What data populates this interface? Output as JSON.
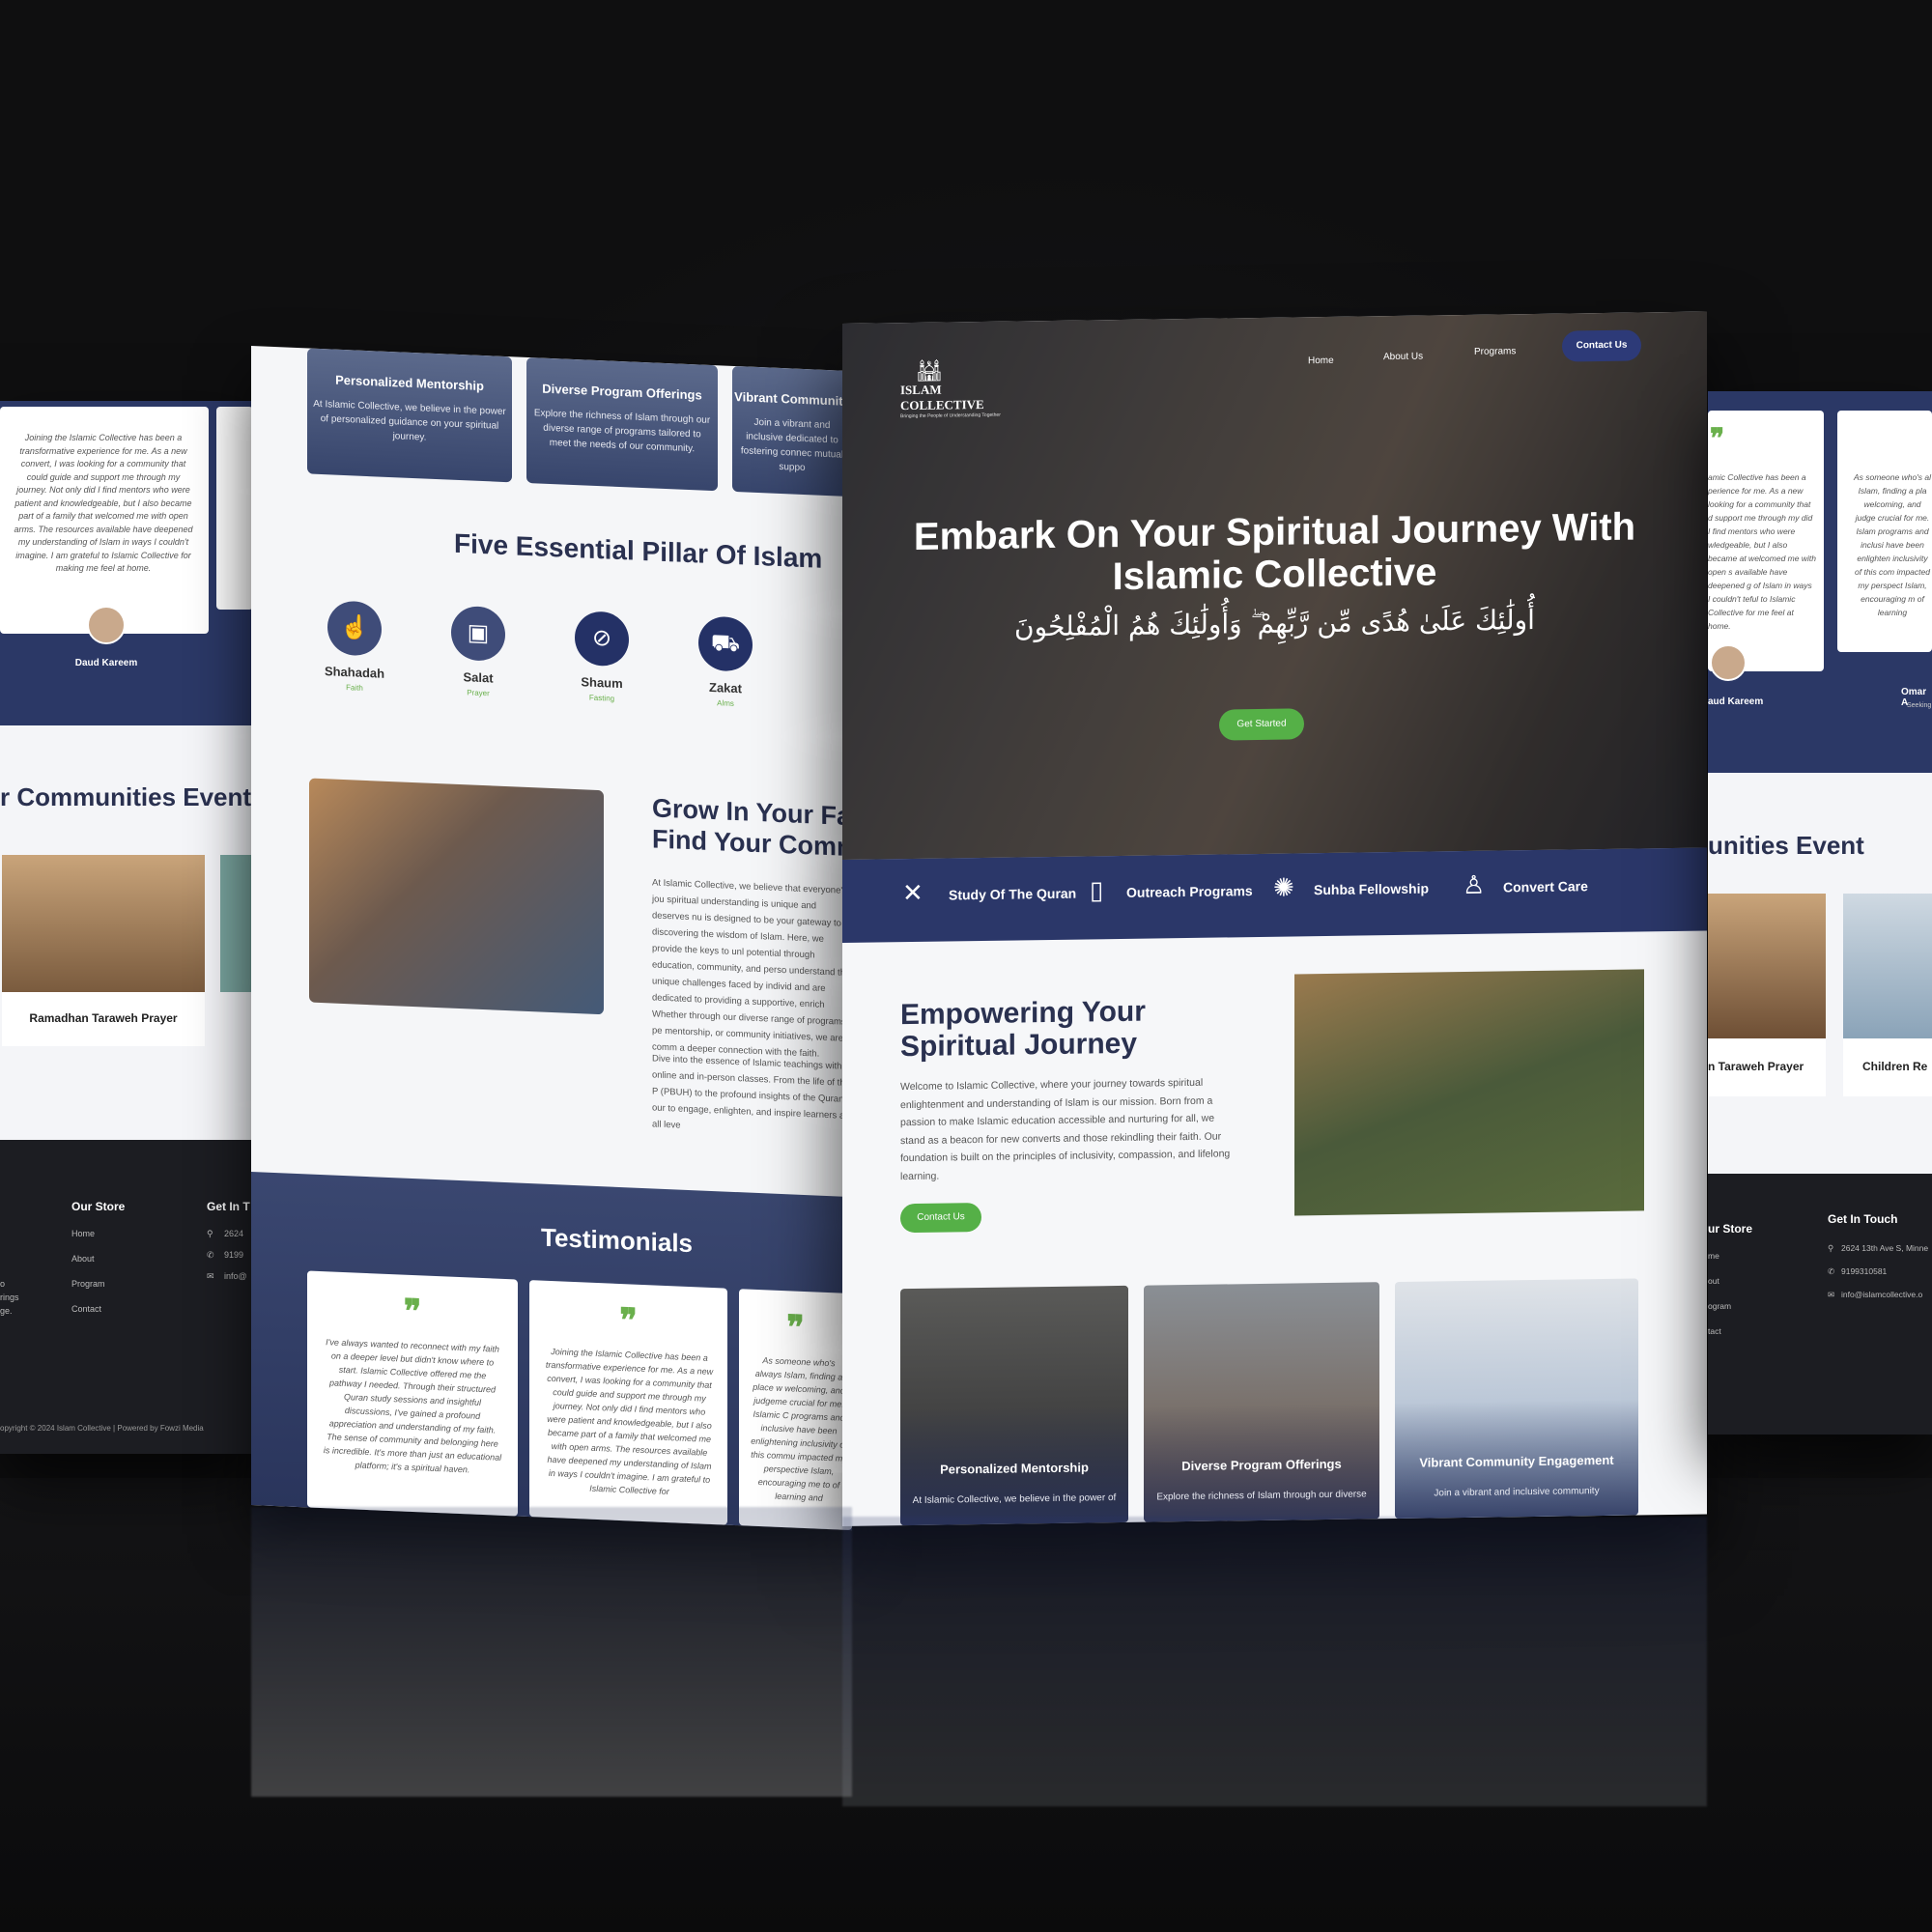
{
  "left_panel": {
    "testimonial_text": "Joining the Islamic Collective has been a transformative experience for me. As a new convert, I was looking for a community that could guide and support me through my journey. Not only did I find mentors who were patient and knowledgeable, but I also became part of a family that welcomed me with open arms. The resources available have deepened my understanding of Islam in ways I couldn't imagine. I am grateful to Islamic Collective for making me feel at home.",
    "testimonial_name": "Daud Kareem",
    "events_title": "r Communities Event",
    "event_caption": "Ramadhan Taraweh Prayer",
    "footer": {
      "store_heading": "Our Store",
      "touch_heading": "Get In T",
      "links": [
        "Home",
        "About",
        "Program",
        "Contact"
      ],
      "partial_links": [
        "o",
        "rings",
        "ge."
      ],
      "contact_partial": [
        "2624",
        "9199",
        "info@"
      ],
      "copyright": "opyright © 2024 Islam Collective | Powered by Fowzi Media"
    }
  },
  "mid_panel": {
    "cards": [
      {
        "title": "Personalized Mentorship",
        "desc": "At Islamic Collective, we believe in the power of personalized guidance on your spiritual journey."
      },
      {
        "title": "Diverse Program Offerings",
        "desc": "Explore the richness of Islam through our diverse range of programs tailored to meet the needs of our community."
      },
      {
        "title": "Vibrant Community",
        "desc": "Join a vibrant and inclusive dedicated to fostering connec mutual suppo"
      }
    ],
    "pillars_title": "Five Essential Pillar Of Islam",
    "pillars": [
      {
        "name": "Shahadah",
        "sub": "Faith",
        "icon": "☝"
      },
      {
        "name": "Salat",
        "sub": "Prayer",
        "icon": "▣"
      },
      {
        "name": "Shaum",
        "sub": "Fasting",
        "icon": "⊘"
      },
      {
        "name": "Zakat",
        "sub": "Alms",
        "icon": "⛟"
      }
    ],
    "grow_title_1": "Grow In Your Fai",
    "grow_title_2": "Find Your Comm",
    "grow_para_1": "At Islamic Collective, we believe that everyone's jou spiritual understanding is unique and deserves nu is designed to be your gateway to discovering the wisdom of Islam. Here, we provide the keys to unl potential through education, community, and perso understand the unique challenges faced by individ and are dedicated to providing a supportive, enrich Whether through our diverse range of programs, pe mentorship, or community initiatives, we are comm a deeper connection with the faith.",
    "grow_para_2": "Dive into the essence of Islamic teachings with ou online and in-person classes. From the life of the P (PBUH) to the profound insights of the Quran, our to engage, enlighten, and inspire learners at all leve",
    "testimonials_title": "Testimonials",
    "testimonials": [
      "I've always wanted to reconnect with my faith on a deeper level but didn't know where to start. Islamic Collective offered me the pathway I needed. Through their structured Quran study sessions and insightful discussions, I've gained a profound appreciation and understanding of my faith. The sense of community and belonging here is incredible. It's more than just an educational platform; it's a spiritual haven.",
      "Joining the Islamic Collective has been a transformative experience for me. As a new convert, I was looking for a community that could guide and support me through my journey. Not only did I find mentors who were patient and knowledgeable, but I also became part of a family that welcomed me with open arms. The resources available have deepened my understanding of Islam in ways I couldn't imagine. I am grateful to Islamic Collective for",
      "As someone who's always Islam, finding a place w welcoming, and judgeme crucial for me. Islamic C programs and inclusive have been enlightening inclusivity of this commu impacted my perspective Islam, encouraging me to of learning and"
    ]
  },
  "main_panel": {
    "logo_wordmark": "ISLAM COLLECTIVE",
    "logo_tagline": "Bringing the People of Understanding Together",
    "nav": [
      "Home",
      "About Us",
      "Programs"
    ],
    "contact_button": "Contact Us",
    "hero_title": "Embark On Your Spiritual Journey With Islamic Collective",
    "hero_arabic": "أُولَٰئِكَ عَلَىٰ هُدًى مِّن رَّبِّهِمْ ۖ وَأُولَٰئِكَ هُمُ الْمُفْلِحُونَ",
    "get_started": "Get Started",
    "features": [
      {
        "label": "Study Of The Quran",
        "icon": "book-icon"
      },
      {
        "label": "Outreach Programs",
        "icon": "door-icon"
      },
      {
        "label": "Suhba Fellowship",
        "icon": "star-pattern-icon"
      },
      {
        "label": "Convert Care",
        "icon": "person-icon"
      }
    ],
    "empower_title_1": "Empowering Your",
    "empower_title_2": "Spiritual Journey",
    "empower_text": "Welcome to Islamic Collective, where your journey towards spiritual enlightenment and understanding of Islam is our mission. Born from a passion to make Islamic education accessible and nurturing for all, we stand as a beacon for new converts and those rekindling their faith. Our foundation is built on the principles of inclusivity, compassion, and lifelong learning.",
    "empower_button": "Contact Us",
    "cards": [
      {
        "title": "Personalized Mentorship",
        "desc": "At Islamic Collective, we believe in the power of"
      },
      {
        "title": "Diverse Program Offerings",
        "desc": "Explore the richness of Islam through our diverse"
      },
      {
        "title": "Vibrant Community Engagement",
        "desc": "Join a vibrant and inclusive community"
      }
    ]
  },
  "right_panel": {
    "testimonial_1": "amic Collective has been a perience for me. As a new looking for a community that d support me through my did I find mentors who were wledgeable, but I also became at welcomed me with open s available have deepened g of Islam in ways I couldn't teful to Islamic Collective for me feel at home.",
    "testimonial_2": "As someone who's al Islam, finding a pla welcoming, and judge crucial for me. Islam programs and inclusi have been enlighten inclusivity of this com impacted my perspect Islam, encouraging m of learning",
    "name_1": "aud Kareem",
    "name_2": "Omar A",
    "name_2_sub": "Seeking",
    "events_title": "unities Event",
    "caption_1": "n Taraweh Prayer",
    "caption_2": "Children Re",
    "footer": {
      "store_heading": "ur Store",
      "touch_heading": "Get In Touch",
      "links": [
        "me",
        "out",
        "ogram",
        "tact"
      ],
      "address": "2624 13th Ave S, Minne",
      "phone": "9199310581",
      "email": "info@islamcollective.o"
    }
  }
}
